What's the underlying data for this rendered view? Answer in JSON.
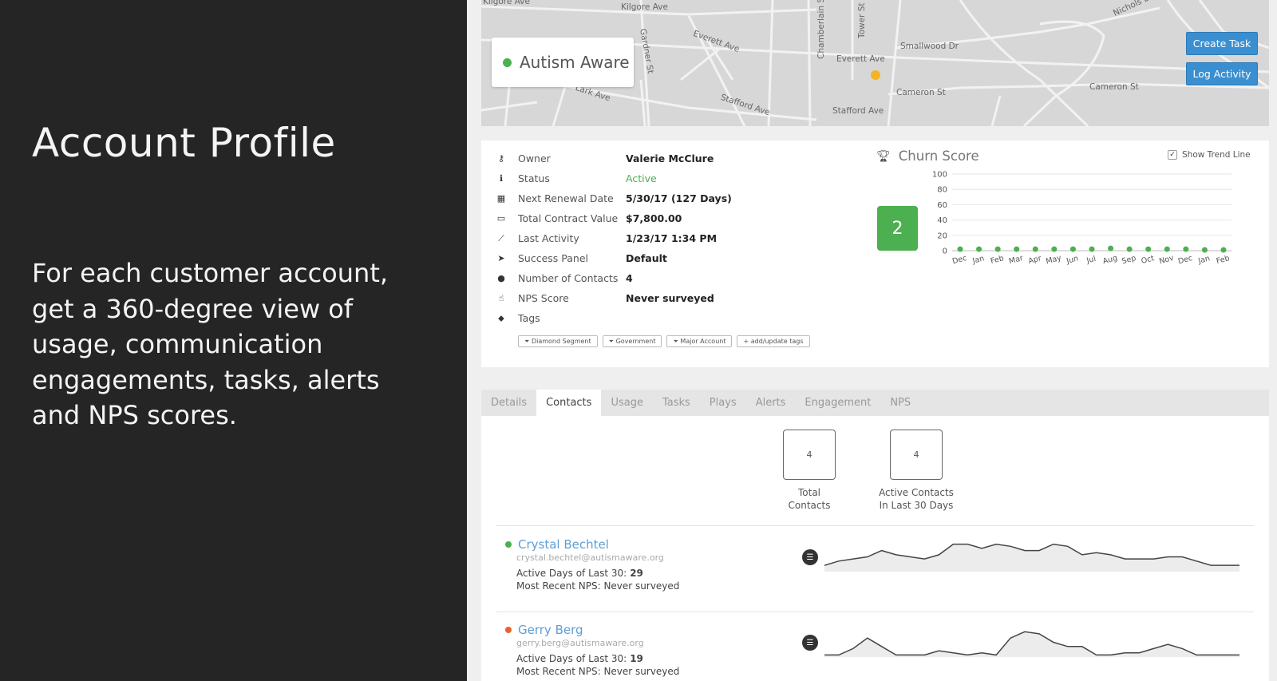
{
  "slide": {
    "title": "Account Profile",
    "description": "For each customer account, get a 360-degree view of usage, communication engagements, tasks, alerts and NPS scores."
  },
  "map": {
    "street_labels": [
      "Kilgore Ave",
      "Kilgore Ave",
      "Gardner St",
      "Everett Ave",
      "Chamberlain St",
      "Tower St",
      "Smallwood Dr",
      "Everett Ave",
      "Nichols Dr",
      "Cameron St",
      "Cameron St",
      "Stafford Ave",
      "Stafford Ave",
      "Lark Ave"
    ],
    "account_name": "Autism Aware",
    "status_color": "#4caf50",
    "marker_color": "#f5b324",
    "buttons": {
      "create_task": "Create Task",
      "log_activity": "Log Activity"
    }
  },
  "profile": {
    "rows": [
      {
        "icon": "key-icon",
        "label": "Owner",
        "value": "Valerie McClure"
      },
      {
        "icon": "info-icon",
        "label": "Status",
        "value": "Active"
      },
      {
        "icon": "calendar-icon",
        "label": "Next Renewal Date",
        "value": "5/30/17 (127 Days)"
      },
      {
        "icon": "money-icon",
        "label": "Total Contract Value",
        "value": "$7,800.00"
      },
      {
        "icon": "line-chart-icon",
        "label": "Last Activity",
        "value": "1/23/17 1:34 PM"
      },
      {
        "icon": "paper-plane-icon",
        "label": "Success Panel",
        "value": "Default"
      },
      {
        "icon": "user-icon",
        "label": "Number of Contacts",
        "value": "4"
      },
      {
        "icon": "thumbs-up-icon",
        "label": "NPS Score",
        "value": "Never surveyed"
      },
      {
        "icon": "tags-icon",
        "label": "Tags",
        "value": ""
      }
    ],
    "tags": [
      "Diamond Segment",
      "Government",
      "Major Account"
    ],
    "add_tags_label": "+ add/update tags"
  },
  "churn": {
    "title": "Churn Score",
    "score": "2",
    "show_trend_label": "Show Trend Line",
    "show_trend_checked": true
  },
  "chart_data": {
    "type": "scatter",
    "title": "",
    "x": [
      "Dec",
      "Jan",
      "Feb",
      "Mar",
      "Apr",
      "May",
      "Jun",
      "Jul",
      "Aug",
      "Sep",
      "Oct",
      "Nov",
      "Dec",
      "Jan",
      "Feb"
    ],
    "values": [
      2,
      2,
      2,
      2,
      2,
      2,
      2,
      2,
      3,
      2,
      2,
      2,
      2,
      1,
      1
    ],
    "ylim": [
      0,
      100
    ],
    "yticks": [
      0,
      20,
      40,
      60,
      80,
      100
    ],
    "color": "#4caf50",
    "grid": true
  },
  "tabs": [
    {
      "label": "Details",
      "active": false
    },
    {
      "label": "Contacts",
      "active": true
    },
    {
      "label": "Usage",
      "active": false
    },
    {
      "label": "Tasks",
      "active": false
    },
    {
      "label": "Plays",
      "active": false
    },
    {
      "label": "Alerts",
      "active": false
    },
    {
      "label": "Engagement",
      "active": false
    },
    {
      "label": "NPS",
      "active": false
    }
  ],
  "stats": {
    "total": {
      "value": "4",
      "caption_line1": "Total",
      "caption_line2": "Contacts"
    },
    "active": {
      "value": "4",
      "caption_line1": "Active Contacts",
      "caption_line2": "In Last 30 Days"
    }
  },
  "contacts": [
    {
      "name": "Crystal Bechtel",
      "email": "crystal.bechtel@autismaware.org",
      "status_color": "#4caf50",
      "active_days_label": "Active Days of Last 30:",
      "active_days": "29",
      "nps_label": "Most Recent NPS: Never surveyed",
      "sparkline": [
        3,
        5,
        6,
        7,
        10,
        8,
        7,
        6,
        8,
        13,
        13,
        11,
        13,
        12,
        10,
        10,
        13,
        12,
        8,
        9,
        8,
        6,
        6,
        6,
        7,
        7,
        5,
        3,
        3,
        3
      ]
    },
    {
      "name": "Gerry Berg",
      "email": "gerry.berg@autismaware.org",
      "status_color": "#e8632b",
      "active_days_label": "Active Days of Last 30:",
      "active_days": "19",
      "nps_label": "Most Recent NPS: Never surveyed",
      "sparkline": [
        1,
        1,
        4,
        9,
        5,
        1,
        1,
        1,
        3,
        2,
        1,
        2,
        1,
        9,
        12,
        11,
        7,
        5,
        5,
        1,
        1,
        2,
        2,
        4,
        6,
        4,
        1,
        1,
        1,
        1
      ]
    }
  ]
}
